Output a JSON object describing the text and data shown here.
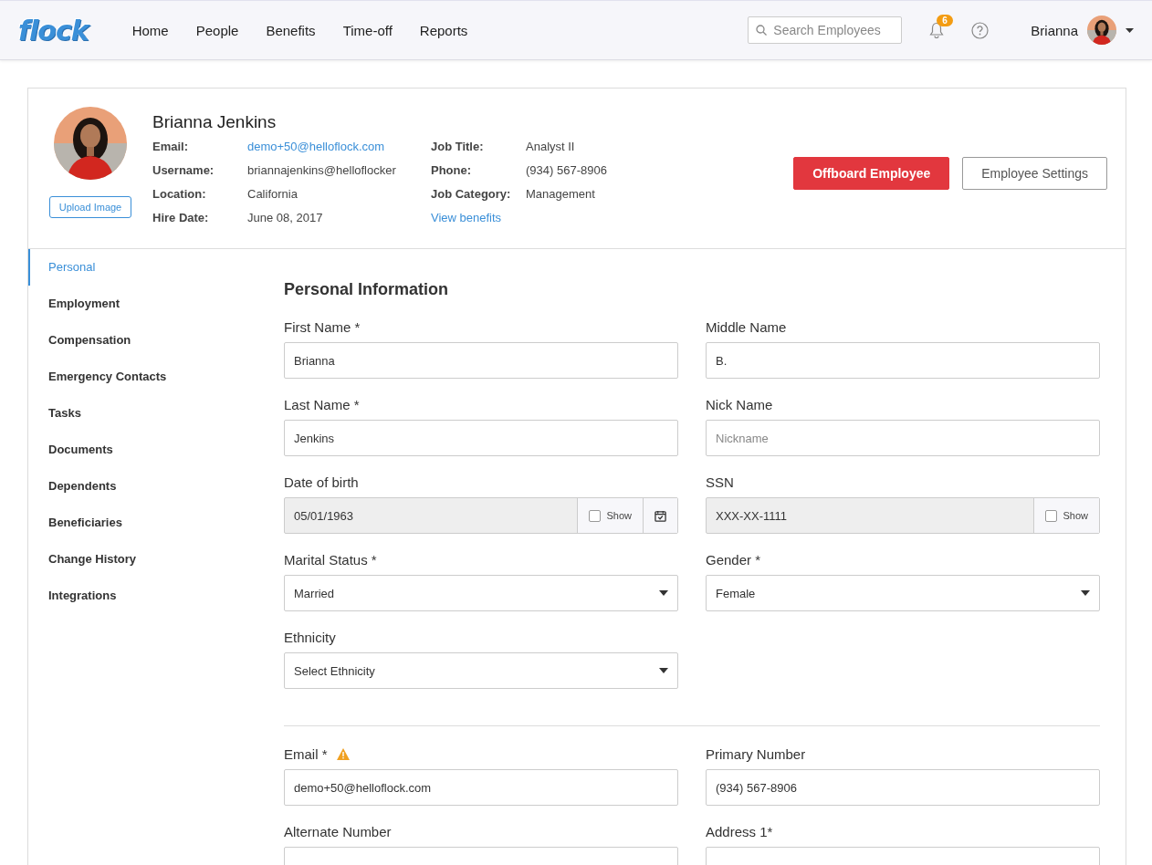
{
  "nav": {
    "logo": "flock",
    "links": [
      "Home",
      "People",
      "Benefits",
      "Time-off",
      "Reports"
    ],
    "search": {
      "placeholder": "Search Employees"
    },
    "notifications": {
      "count": "6"
    },
    "user": {
      "name": "Brianna"
    }
  },
  "profile": {
    "name": "Brianna Jenkins",
    "upload_button": "Upload Image",
    "details": [
      [
        {
          "kind": "pair",
          "label": "Email:",
          "value": "demo+50@helloflock.com",
          "link": true
        },
        {
          "kind": "pair",
          "label": "Username:",
          "value": "briannajenkins@helloflocker",
          "link": false
        },
        {
          "kind": "pair",
          "label": "Location:",
          "value": "California",
          "link": false
        },
        {
          "kind": "pair",
          "label": "Hire Date:",
          "value": "June 08, 2017",
          "link": false
        }
      ],
      [
        {
          "kind": "pair",
          "label": "Job Title:",
          "value": "Analyst II",
          "link": false
        },
        {
          "kind": "pair",
          "label": "Phone:",
          "value": "(934) 567-8906",
          "link": false
        },
        {
          "kind": "pair",
          "label": "Job Category:",
          "value": "Management",
          "link": false
        },
        {
          "kind": "link",
          "value": "View benefits"
        }
      ]
    ],
    "buttons": [
      {
        "label": "Offboard Employee",
        "kind": "primary"
      },
      {
        "label": "Employee Settings",
        "kind": "outline"
      }
    ]
  },
  "sidebar": {
    "items": [
      {
        "label": "Personal",
        "selected": true
      },
      {
        "label": "Employment",
        "selected": false
      },
      {
        "label": "Compensation",
        "selected": false
      },
      {
        "label": "Emergency Contacts",
        "selected": false
      },
      {
        "label": "Tasks",
        "selected": false
      },
      {
        "label": "Documents",
        "selected": false
      },
      {
        "label": "Dependents",
        "selected": false
      },
      {
        "label": "Beneficiaries",
        "selected": false
      },
      {
        "label": "Change History",
        "selected": false
      },
      {
        "label": "Integrations",
        "selected": false
      }
    ]
  },
  "form": {
    "title": "Personal Information",
    "sections": [
      {
        "fields": [
          {
            "kind": "text",
            "label": "First Name *",
            "value": "Brianna"
          },
          {
            "kind": "text",
            "label": "Middle Name",
            "value": "B."
          },
          {
            "kind": "text",
            "label": "Last Name *",
            "value": "Jenkins"
          },
          {
            "kind": "text",
            "label": "Nick Name",
            "placeholder": "Nickname"
          },
          {
            "kind": "masked",
            "label": "Date of birth",
            "value": "05/01/1963",
            "show": {
              "label": "Show",
              "checked": false
            },
            "calendar": true
          },
          {
            "kind": "masked",
            "label": "SSN",
            "value": "XXX-XX-1111",
            "show": {
              "label": "Show",
              "checked": false
            },
            "calendar": false
          },
          {
            "kind": "select",
            "label": "Marital Status *",
            "value": "Married"
          },
          {
            "kind": "select",
            "label": "Gender *",
            "value": "Female"
          },
          {
            "kind": "select",
            "label": "Ethnicity",
            "value": "Select Ethnicity"
          }
        ]
      },
      {
        "fields": [
          {
            "kind": "text",
            "label": "Email *",
            "warning": true,
            "value": "demo+50@helloflock.com"
          },
          {
            "kind": "text",
            "label": "Primary Number",
            "value": "(934) 567-8906"
          },
          {
            "kind": "text",
            "label": "Alternate Number"
          },
          {
            "kind": "text",
            "label": "Address 1*"
          }
        ]
      }
    ]
  }
}
